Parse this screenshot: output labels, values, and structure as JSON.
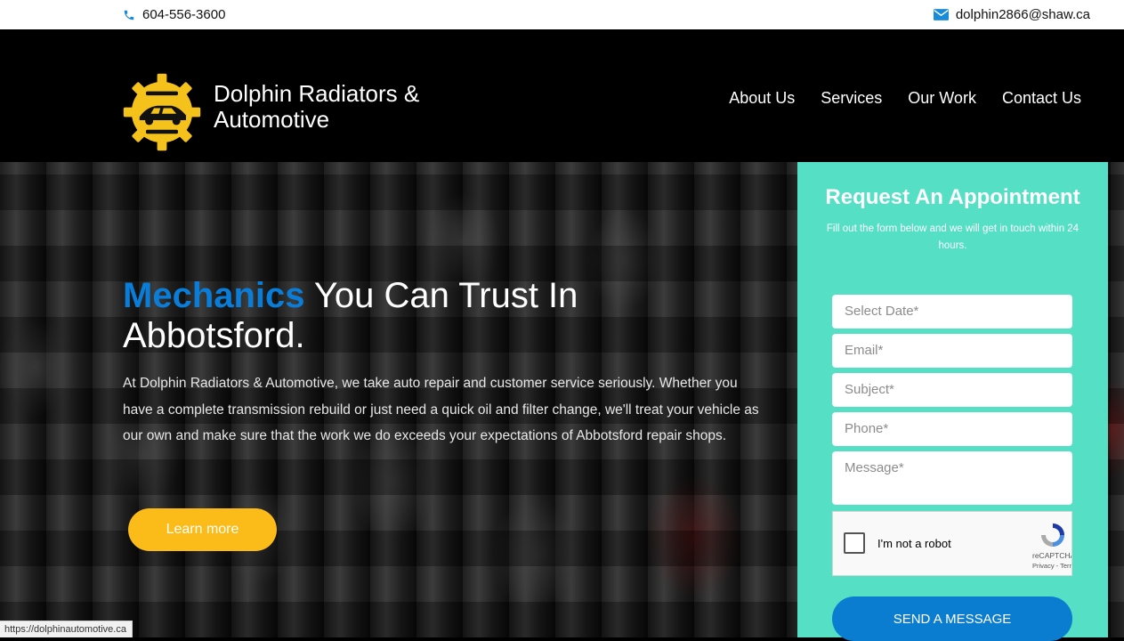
{
  "topbar": {
    "phone": "604-556-3600",
    "email": "dolphin2866@shaw.ca"
  },
  "header": {
    "brand": "Dolphin Radiators & Automotive",
    "nav": [
      "About Us",
      "Services",
      "Our Work",
      "Contact Us"
    ]
  },
  "hero": {
    "headline_accent": "Mechanics",
    "headline_rest": " You Can Trust In Abbotsford.",
    "intro": "At Dolphin Radiators & Automotive, we take auto repair and customer service seriously. Whether you have a complete transmission rebuild or just need a quick oil and filter change, we'll treat your vehicle as our own and make sure that the work we do exceeds your expectations of Abbotsford repair shops.",
    "cta": "Learn more"
  },
  "form": {
    "title": "Request An Appointment",
    "subtitle": "Fill out the form below and we will get in touch within 24 hours.",
    "fields": {
      "date": "Select Date*",
      "email": "Email*",
      "subject": "Subject*",
      "phone": "Phone*",
      "message": "Message*"
    },
    "captcha_label": "I'm not a robot",
    "captcha_brand": "reCAPTCHA",
    "captcha_terms": "Privacy - Terms",
    "submit": "SEND A MESSAGE"
  },
  "status_url": "https://dolphinautomotive.ca",
  "colors": {
    "accent_blue": "#0a7dd8",
    "cta_yellow": "#fbbb18",
    "panel_teal": "#55dfc5",
    "logo_yellow": "#f5c21b"
  }
}
